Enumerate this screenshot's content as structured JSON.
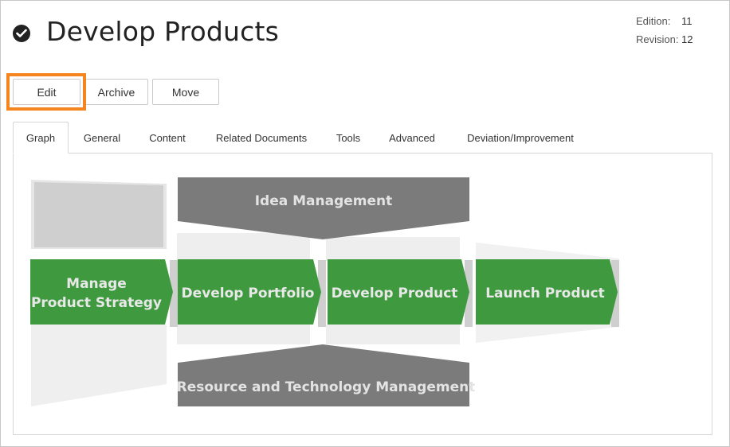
{
  "header": {
    "title": "Develop Products",
    "status_icon": "check-circle-icon",
    "edition_label": "Edition:",
    "edition_value": "11",
    "revision_label": "Revision:",
    "revision_value": "12"
  },
  "toolbar": {
    "edit_label": "Edit",
    "archive_label": "Archive",
    "move_label": "Move",
    "highlight_color": "#f5861f"
  },
  "tabs": [
    {
      "label": "Graph",
      "active": true
    },
    {
      "label": "General"
    },
    {
      "label": "Content"
    },
    {
      "label": "Related Documents"
    },
    {
      "label": "Tools"
    },
    {
      "label": "Advanced"
    },
    {
      "label": "Deviation/Improvement"
    }
  ],
  "graph": {
    "top_banner": "Idea Management",
    "bottom_banner": "Resource and Technology Management",
    "steps": [
      {
        "line1": "Manage",
        "line2": "Product Strategy"
      },
      {
        "line1": "Develop Portfolio"
      },
      {
        "line1": "Develop Product"
      },
      {
        "line1": "Launch Product"
      }
    ],
    "step_color": "#3f9a3f",
    "banner_color": "#7b7b7b"
  }
}
